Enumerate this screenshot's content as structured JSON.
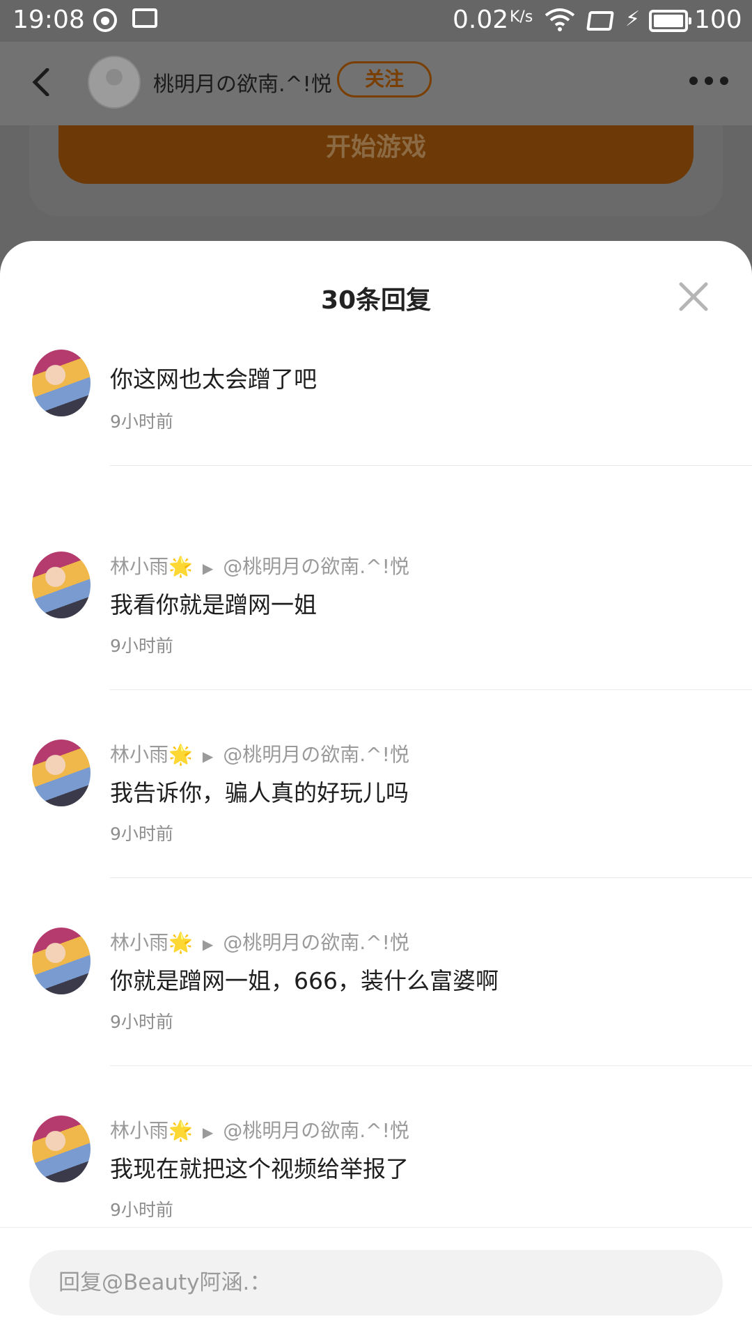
{
  "status_bar": {
    "time": "19:08",
    "net_speed": "0.02",
    "net_speed_unit": "K/s",
    "battery": "100"
  },
  "header": {
    "author_name": "桃明月の欲南.^!悦",
    "follow_label": "关注"
  },
  "game": {
    "start_label": "开始游戏"
  },
  "sheet": {
    "title": "30条回复",
    "replies": [
      {
        "author": "",
        "star": "",
        "target": "",
        "text": "你这网也太会蹭了吧",
        "time": "9小时前"
      },
      {
        "author": "林小雨",
        "star": "🌟",
        "target": "@桃明月の欲南.^!悦",
        "text": "我看你就是蹭网一姐",
        "time": "9小时前"
      },
      {
        "author": "林小雨",
        "star": "🌟",
        "target": "@桃明月の欲南.^!悦",
        "text": "我告诉你，骗人真的好玩儿吗",
        "time": "9小时前"
      },
      {
        "author": "林小雨",
        "star": "🌟",
        "target": "@桃明月の欲南.^!悦",
        "text": "你就是蹭网一姐，666，装什么富婆啊",
        "time": "9小时前"
      },
      {
        "author": "林小雨",
        "star": "🌟",
        "target": "@桃明月の欲南.^!悦",
        "text": "我现在就把这个视频给举报了",
        "time": "9小时前"
      }
    ]
  },
  "reply_bar": {
    "placeholder": "回复@Beauty阿涵.："
  },
  "colors": {
    "accent": "#e9890f",
    "overlay": "#666666"
  }
}
